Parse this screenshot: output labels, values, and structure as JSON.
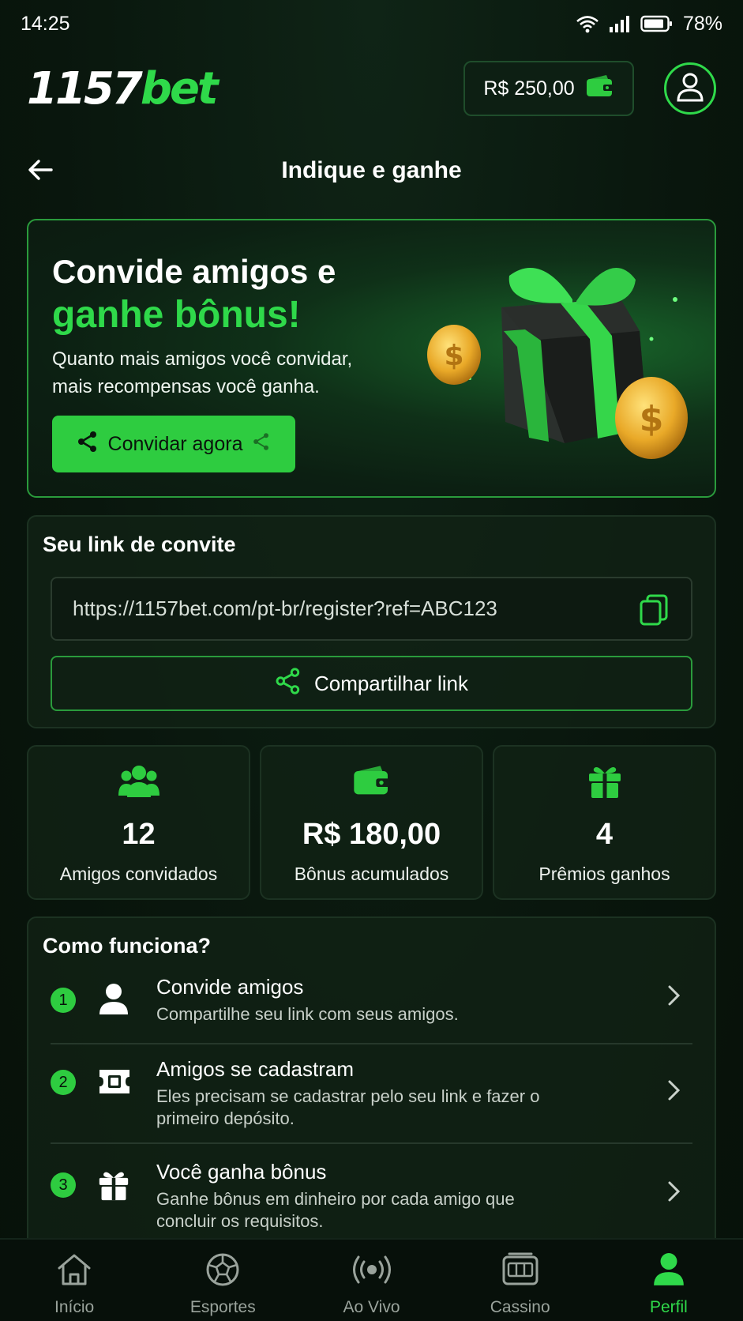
{
  "status_bar": {
    "time": "14:25",
    "battery": "78%"
  },
  "header": {
    "logo_number": "1157",
    "logo_bet": "bet",
    "balance": "R$ 250,00"
  },
  "page": {
    "title": "Indique e ganhe"
  },
  "hero": {
    "title_line1": "Convide amigos e",
    "title_line2": "ganhe bônus!",
    "subtitle": "Quanto mais amigos você convidar, mais recompensas você ganha.",
    "button_label": "Convidar agora"
  },
  "invite_link": {
    "title": "Seu link de convite",
    "url": "https://1157bet.com/pt-br/register?ref=ABC123",
    "share_label": "Compartilhar link"
  },
  "stats": [
    {
      "value": "12",
      "label": "Amigos convidados",
      "icon": "friends-icon"
    },
    {
      "value": "R$ 180,00",
      "label": "Bônus acumulados",
      "icon": "wallet-icon"
    },
    {
      "value": "4",
      "label": "Prêmios ganhos",
      "icon": "gift-icon"
    }
  ],
  "how_it_works": {
    "title": "Como funciona?",
    "steps": [
      {
        "number": "1",
        "title": "Convide amigos",
        "description": "Compartilhe seu link com seus amigos.",
        "icon": "user-icon"
      },
      {
        "number": "2",
        "title": "Amigos se cadastram",
        "description": "Eles precisam se cadastrar pelo seu link e fazer o primeiro depósito.",
        "icon": "ticket-icon"
      },
      {
        "number": "3",
        "title": "Você ganha bônus",
        "description": "Ganhe bônus em dinheiro por cada amigo que concluir os requisitos.",
        "icon": "gift-icon"
      }
    ]
  },
  "bottom_nav": [
    {
      "label": "Início",
      "icon": "home-icon"
    },
    {
      "label": "Esportes",
      "icon": "soccer-ball-icon"
    },
    {
      "label": "Ao Vivo",
      "icon": "live-broadcast-icon"
    },
    {
      "label": "Cassino",
      "icon": "slot-machine-icon"
    },
    {
      "label": "Perfil",
      "icon": "profile-icon",
      "active": true
    }
  ],
  "colors": {
    "accent": "#2fd94a",
    "background": "#0b1a10",
    "card_border": "#1c3222"
  }
}
